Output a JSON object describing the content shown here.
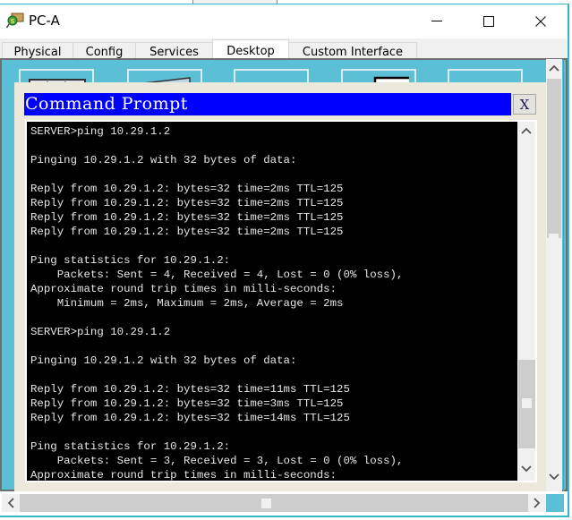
{
  "window": {
    "title": "PC-A",
    "controls": {
      "minimize": "minimize",
      "maximize": "maximize",
      "close": "close"
    }
  },
  "tabs": [
    {
      "label": "Physical",
      "active": false
    },
    {
      "label": "Config",
      "active": false
    },
    {
      "label": "Services",
      "active": false
    },
    {
      "label": "Desktop",
      "active": true
    },
    {
      "label": "Custom Interface",
      "active": false
    }
  ],
  "desktop_icons": [
    "ip-configuration-icon",
    "dial-up-icon",
    "terminal-icon",
    "command-prompt-icon",
    "web-browser-icon"
  ],
  "command_prompt": {
    "title": "Command Prompt",
    "close_label": "X",
    "lines": [
      "SERVER>ping 10.29.1.2",
      "",
      "Pinging 10.29.1.2 with 32 bytes of data:",
      "",
      "Reply from 10.29.1.2: bytes=32 time=2ms TTL=125",
      "Reply from 10.29.1.2: bytes=32 time=2ms TTL=125",
      "Reply from 10.29.1.2: bytes=32 time=2ms TTL=125",
      "Reply from 10.29.1.2: bytes=32 time=2ms TTL=125",
      "",
      "Ping statistics for 10.29.1.2:",
      "    Packets: Sent = 4, Received = 4, Lost = 0 (0% loss),",
      "Approximate round trip times in milli-seconds:",
      "    Minimum = 2ms, Maximum = 2ms, Average = 2ms",
      "",
      "SERVER>ping 10.29.1.2",
      "",
      "Pinging 10.29.1.2 with 32 bytes of data:",
      "",
      "Reply from 10.29.1.2: bytes=32 time=11ms TTL=125",
      "Reply from 10.29.1.2: bytes=32 time=3ms TTL=125",
      "Reply from 10.29.1.2: bytes=32 time=14ms TTL=125",
      "",
      "Ping statistics for 10.29.1.2:",
      "    Packets: Sent = 3, Received = 3, Lost = 0 (0% loss),",
      "Approximate round trip times in milli-seconds:"
    ]
  },
  "colors": {
    "accent_title_bar": "#0000ff",
    "desktop_background": "#5bbfd6",
    "window_border": "#35b6c6",
    "terminal_background": "#000000",
    "terminal_text": "#e6e6e6"
  }
}
